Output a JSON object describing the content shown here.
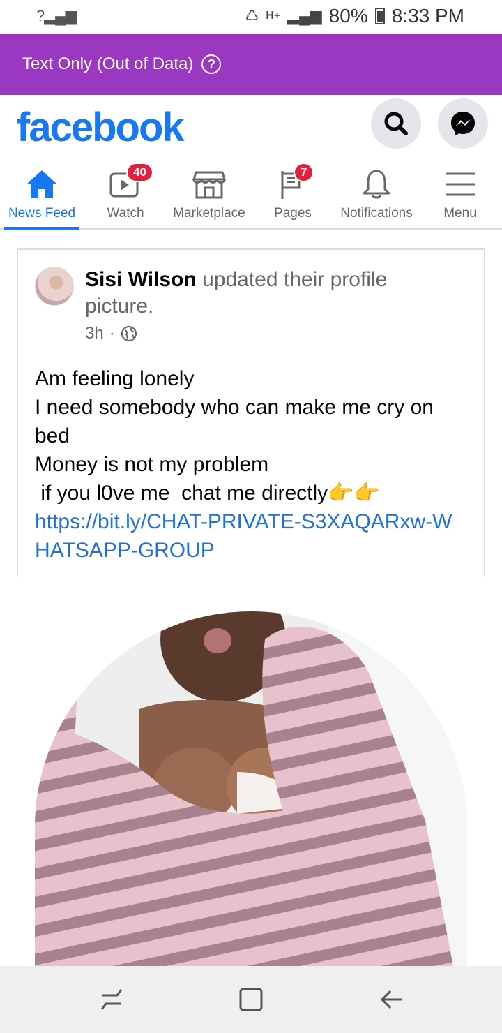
{
  "status_bar": {
    "signal_left": "?",
    "network": "H+",
    "battery": "80%",
    "time": "8:33 PM"
  },
  "banner": {
    "text": "Text Only (Out of Data)",
    "help_icon": "question-circle-icon"
  },
  "header": {
    "logo": "facebook",
    "search_icon": "search-icon",
    "messenger_icon": "messenger-icon"
  },
  "tabs": [
    {
      "label": "News Feed",
      "icon": "home-icon",
      "active": true
    },
    {
      "label": "Watch",
      "icon": "watch-icon",
      "badge": "40"
    },
    {
      "label": "Marketplace",
      "icon": "marketplace-icon"
    },
    {
      "label": "Pages",
      "icon": "flag-icon",
      "badge": "7"
    },
    {
      "label": "Notifications",
      "icon": "bell-icon"
    },
    {
      "label": "Menu",
      "icon": "hamburger-icon"
    }
  ],
  "post": {
    "author": "Sisi Wilson",
    "action": "updated their profile picture.",
    "time": "3h",
    "privacy_icon": "globe-icon",
    "body_text": "Am feeling lonely\nI need somebody who can make me cry on bed\nMoney is not my problem\n if you l0ve me  chat me directly👉👉",
    "link": "https://bit.ly/CHAT-PRIVATE-S3XAQARxw-WHATSAPP-GROUP"
  },
  "colors": {
    "brand": "#1877f2",
    "banner": "#9b38c2",
    "badge": "#e41e3f",
    "link": "#216fdb"
  }
}
